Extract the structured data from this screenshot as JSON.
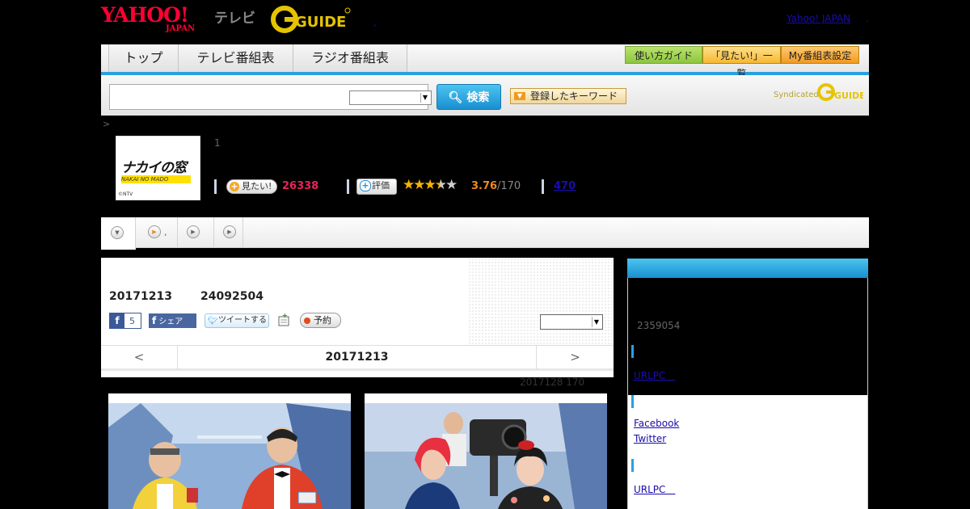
{
  "header": {
    "yahoo_logo_top": "YAHOO!",
    "yahoo_logo_bottom": "JAPAN",
    "tv_label": "テレビ",
    "gguide_logo": "GUIDE",
    "yahoo_japan_link": "Yahoo! JAPAN",
    "trailing_dot": ".",
    "mid_dot": ","
  },
  "nav": {
    "tabs": [
      "トップ",
      "テレビ番組表",
      "ラジオ番組表"
    ],
    "buttons": [
      "使い方ガイド",
      "「見たい!」一覧",
      "My番組表設定"
    ]
  },
  "search": {
    "input_value": "",
    "select_value": "",
    "search_button": "検索",
    "keyword_button": "登録したキーワード",
    "syndicated": "Syndicated",
    "syndicated_logo": "GUIDE"
  },
  "breadcrumb": ">",
  "program": {
    "image_title": "ナカイの窓",
    "image_subtitle": "NAKAI NO MADO",
    "copyright": "©NTV",
    "number": "1",
    "mitai_label": "見たい!",
    "mitai_count": "26338",
    "rate_label": "評価",
    "rating": "3.76",
    "rating_max": "/170",
    "stars_value": 3.76,
    "review_link": "470"
  },
  "subtabs": {
    "items": [
      "",
      ",",
      "",
      ""
    ]
  },
  "episode": {
    "date": "20171213",
    "code": "24092504",
    "fb_like_count": "5",
    "fb_share": "シェア",
    "tweet": "ツイートする",
    "reserve": "予約",
    "select_value": "",
    "pager_prev": "<",
    "pager_current": "20171213",
    "pager_next": ">",
    "note": "2017128  170"
  },
  "sidebar": {
    "count": "2359054",
    "url_link_1": "URLPC　",
    "facebook": "Facebook",
    "twitter": "Twitter",
    "url_link_2": "URLPC　"
  },
  "colors": {
    "accent_blue": "#2aa0e0",
    "pink": "#e8245a",
    "orange": "#f08a20",
    "link": "#1a0dab"
  },
  "icons": [
    "search-icon",
    "plus-icon",
    "star-icon",
    "play-icon",
    "dropdown-arrow-icon",
    "facebook-icon",
    "twitter-bird-icon",
    "record-dot-icon",
    "add-calendar-icon"
  ]
}
